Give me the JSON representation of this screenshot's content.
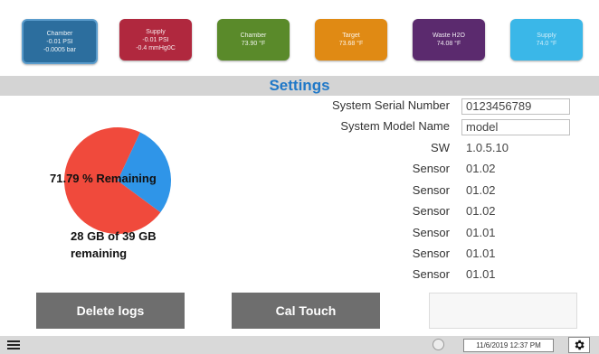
{
  "tiles": [
    {
      "title": "Chamber",
      "line1": "-0.01 PSI",
      "line2": "-0.0005 bar"
    },
    {
      "title": "Supply",
      "line1": "-0.01 PSI",
      "line2": "-0.4 mmHg0C"
    },
    {
      "title": "Chamber",
      "line1": "73.90 °F",
      "line2": ""
    },
    {
      "title": "Target",
      "line1": "73.68 °F",
      "line2": ""
    },
    {
      "title": "Waste H2O",
      "line1": "74.08 °F",
      "line2": ""
    },
    {
      "title": "Supply",
      "line1": "74.0 °F",
      "line2": ""
    }
  ],
  "header": {
    "title": "Settings"
  },
  "storage": {
    "remaining_percent": 71.79,
    "remaining_label": "71.79 % Remaining",
    "summary_line1": "28 GB of 39 GB",
    "summary_line2": "remaining",
    "colors": {
      "remaining": "#f04a3c",
      "used": "#2f95e8"
    }
  },
  "info": {
    "serial_label": "System Serial Number",
    "serial_value": "0123456789",
    "model_label": "System Model Name",
    "model_value": "model",
    "sw_label": "SW",
    "sw_value": "1.0.5.10",
    "sensors": [
      {
        "label": "Sensor",
        "value": "01.02"
      },
      {
        "label": "Sensor",
        "value": "01.02"
      },
      {
        "label": "Sensor",
        "value": "01.02"
      },
      {
        "label": "Sensor",
        "value": "01.01"
      },
      {
        "label": "Sensor",
        "value": "01.01"
      },
      {
        "label": "Sensor",
        "value": "01.01"
      }
    ]
  },
  "buttons": {
    "delete_logs": "Delete logs",
    "cal_touch": "Cal Touch"
  },
  "statusbar": {
    "datetime": "11/6/2019 12:37 PM"
  }
}
